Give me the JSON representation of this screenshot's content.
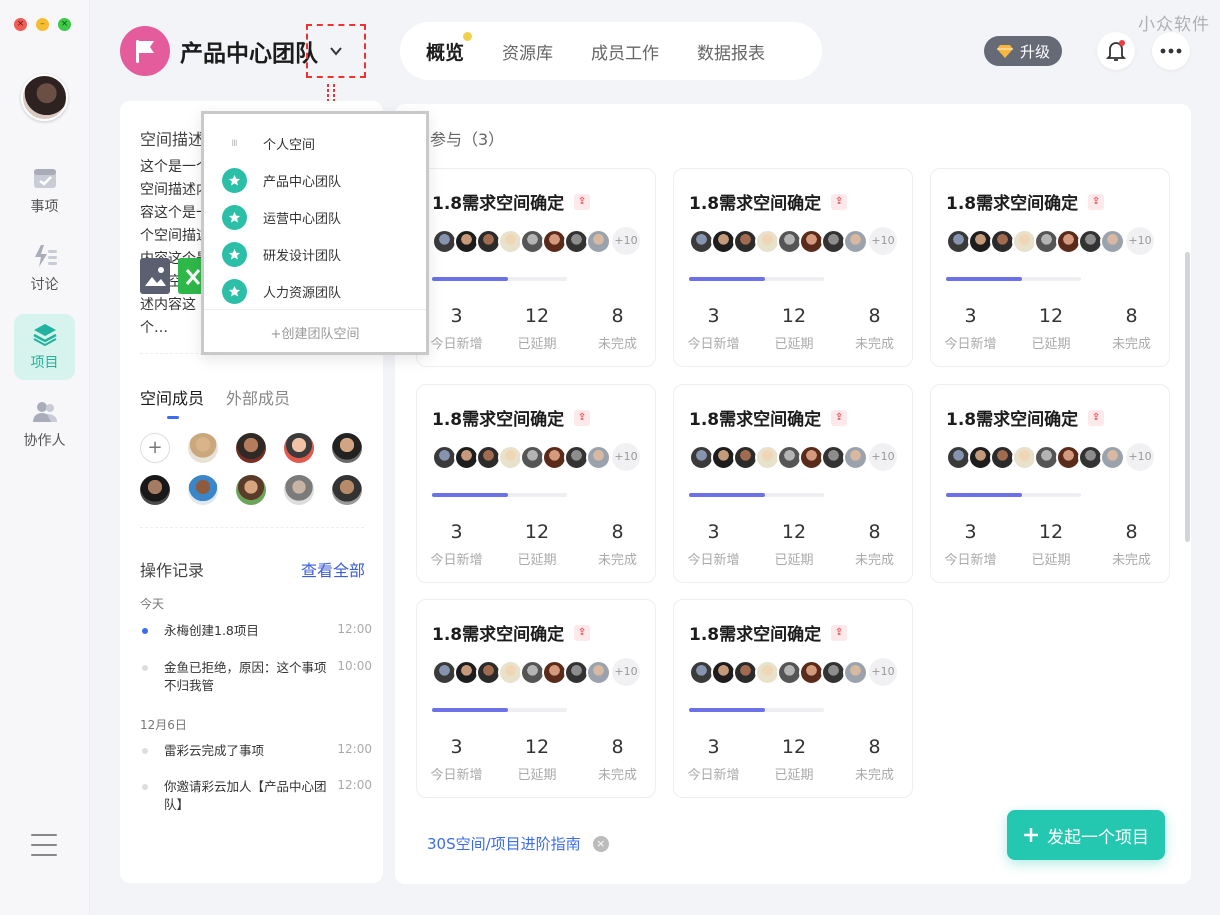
{
  "watermark": "小众软件",
  "team": {
    "name": "产品中心团队",
    "logo_color": "#e45c9c"
  },
  "nav": {
    "tabs": [
      {
        "label": "概览",
        "active": true
      },
      {
        "label": "资源库"
      },
      {
        "label": "成员工作"
      },
      {
        "label": "数据报表"
      }
    ]
  },
  "header": {
    "upgrade_label": "升级",
    "bell_icon": "bell-icon",
    "more_icon": "more-icon"
  },
  "rail": {
    "items": [
      {
        "label": "事项",
        "icon": "calendar-check-icon"
      },
      {
        "label": "讨论",
        "icon": "bolt-list-icon"
      },
      {
        "label": "项目",
        "icon": "layers-icon",
        "active": true
      },
      {
        "label": "协作人",
        "icon": "people-icon"
      }
    ]
  },
  "left_panel": {
    "desc_title": "空间描述",
    "desc_text": "这个是一个空间描述内容这个是一个空间描述内容这个是一个空间描述内容这个…",
    "member_tabs": [
      "空间成员",
      "外部成员"
    ],
    "members_add": "+",
    "log_title": "操作记录",
    "log_view_all": "查看全部",
    "logs": [
      {
        "day": "今天",
        "entries": [
          {
            "text": "永梅创建1.8项目",
            "time": "12:00",
            "highlight": true
          },
          {
            "text": "金鱼已拒绝，原因：这个事项不归我管",
            "time": "10:00"
          }
        ]
      },
      {
        "day": "12月6日",
        "entries": [
          {
            "text": "雷彩云完成了事项",
            "time": "12:00"
          },
          {
            "text": "你邀请彩云加人【产品中心团队】",
            "time": "12:00"
          }
        ]
      }
    ]
  },
  "dropdown": {
    "items": [
      "个人空间",
      "产品中心团队",
      "运营中心团队",
      "研发设计团队",
      "人力资源团队"
    ],
    "personal_badge": "Ⅲ",
    "create_label": "+创建团队空间"
  },
  "main": {
    "title_partial": "参与（3）",
    "cards": [
      {
        "name": "1.8需求空间确定",
        "more": "+10",
        "progress": 0.56,
        "stats": [
          {
            "value": "3",
            "label": "今日新增"
          },
          {
            "value": "12",
            "label": "已延期"
          },
          {
            "value": "8",
            "label": "未完成"
          }
        ]
      },
      {
        "name": "1.8需求空间确定",
        "more": "+10",
        "progress": 0.56,
        "stats": [
          {
            "value": "3",
            "label": "今日新增"
          },
          {
            "value": "12",
            "label": "已延期"
          },
          {
            "value": "8",
            "label": "未完成"
          }
        ]
      },
      {
        "name": "1.8需求空间确定",
        "more": "+10",
        "progress": 0.56,
        "stats": [
          {
            "value": "3",
            "label": "今日新增"
          },
          {
            "value": "12",
            "label": "已延期"
          },
          {
            "value": "8",
            "label": "未完成"
          }
        ]
      },
      {
        "name": "1.8需求空间确定",
        "more": "+10",
        "progress": 0.56,
        "stats": [
          {
            "value": "3",
            "label": "今日新增"
          },
          {
            "value": "12",
            "label": "已延期"
          },
          {
            "value": "8",
            "label": "未完成"
          }
        ]
      },
      {
        "name": "1.8需求空间确定",
        "more": "+10",
        "progress": 0.56,
        "stats": [
          {
            "value": "3",
            "label": "今日新增"
          },
          {
            "value": "12",
            "label": "已延期"
          },
          {
            "value": "8",
            "label": "未完成"
          }
        ]
      },
      {
        "name": "1.8需求空间确定",
        "more": "+10",
        "progress": 0.56,
        "stats": [
          {
            "value": "3",
            "label": "今日新增"
          },
          {
            "value": "12",
            "label": "已延期"
          },
          {
            "value": "8",
            "label": "未完成"
          }
        ]
      },
      {
        "name": "1.8需求空间确定",
        "more": "+10",
        "progress": 0.56,
        "stats": [
          {
            "value": "3",
            "label": "今日新增"
          },
          {
            "value": "12",
            "label": "已延期"
          },
          {
            "value": "8",
            "label": "未完成"
          }
        ]
      },
      {
        "name": "1.8需求空间确定",
        "more": "+10",
        "progress": 0.56,
        "stats": [
          {
            "value": "3",
            "label": "今日新增"
          },
          {
            "value": "12",
            "label": "已延期"
          },
          {
            "value": "8",
            "label": "未完成"
          }
        ]
      }
    ],
    "guide_label": "30S空间/项目进阶指南",
    "new_project_label": "发起一个项目"
  },
  "colors": {
    "accent": "#24c8b1",
    "link": "#3b6cf0",
    "progress": "#6c71e8"
  }
}
